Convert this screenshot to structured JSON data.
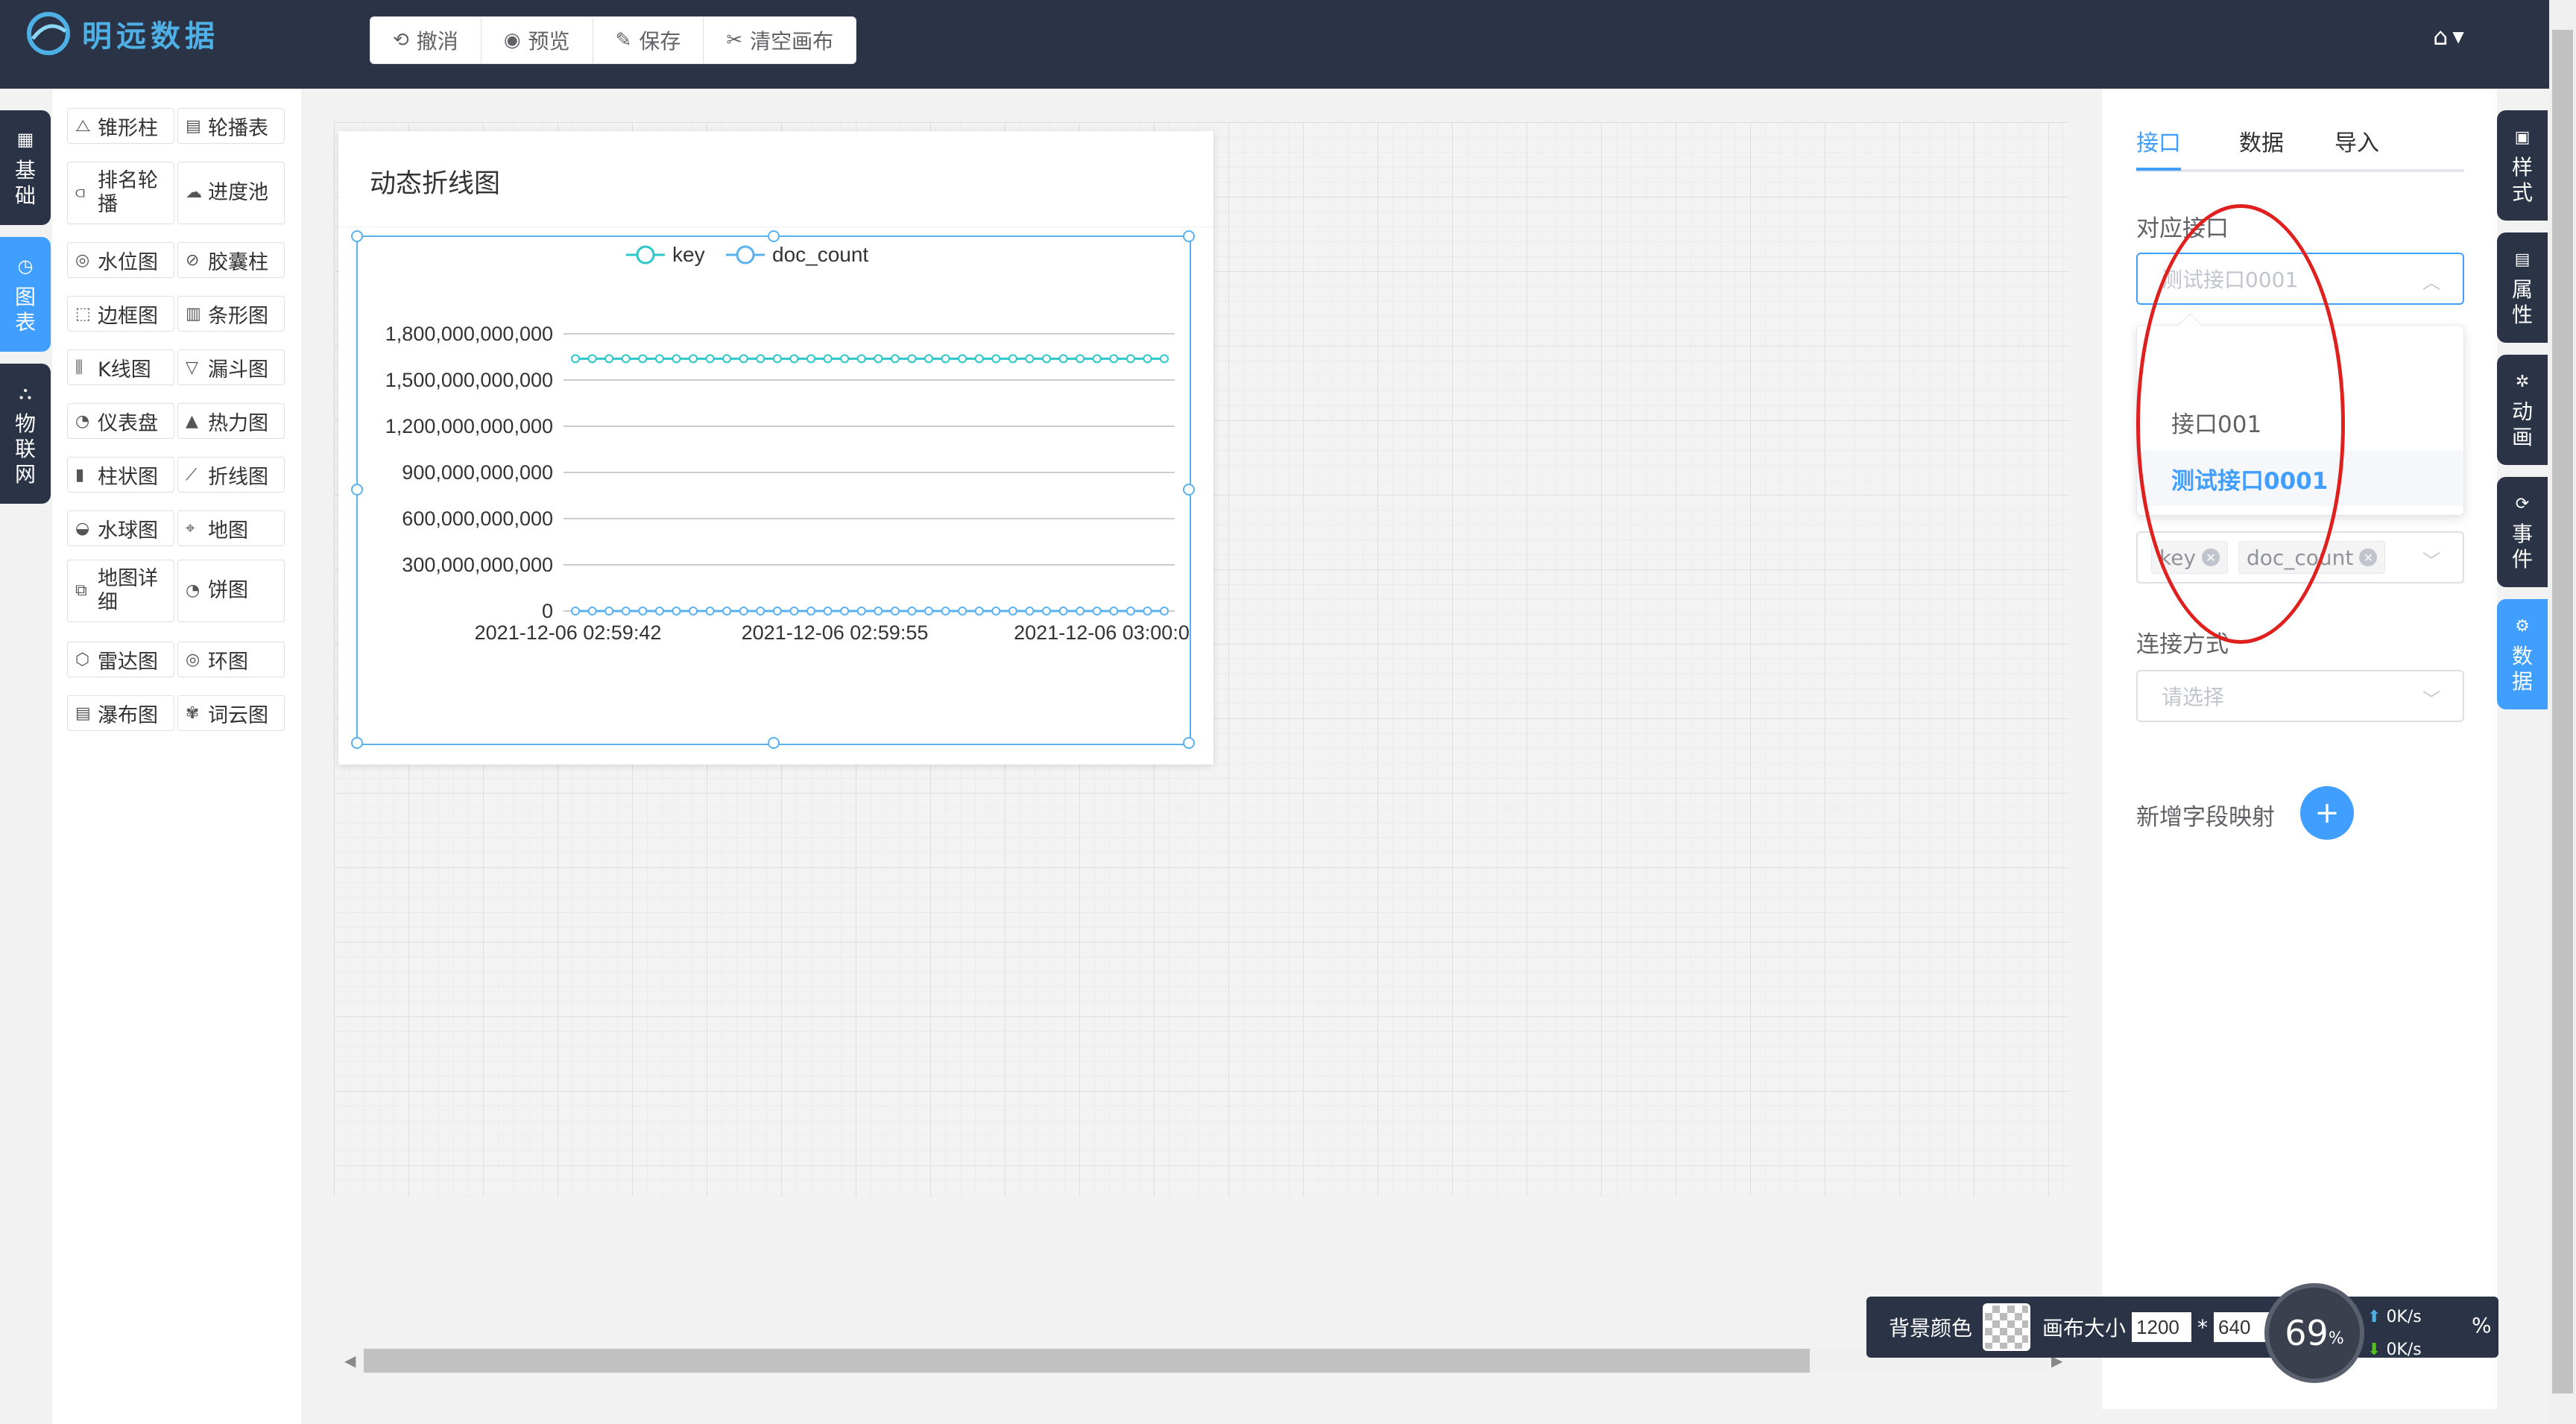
{
  "app": {
    "brand": "明远数据"
  },
  "toolbar": {
    "undo": "撤消",
    "preview": "预览",
    "save": "保存",
    "clear": "清空画布"
  },
  "left_tabs": [
    {
      "label": "基础",
      "icon": "grid-icon",
      "glyph": "▦"
    },
    {
      "label": "图表",
      "icon": "clock-icon",
      "glyph": "◷"
    },
    {
      "label": "物联网",
      "icon": "network-icon",
      "glyph": "⛬"
    }
  ],
  "palette": [
    {
      "label": "锥形柱",
      "glyph": "⧍"
    },
    {
      "label": "轮播表",
      "glyph": "▤"
    },
    {
      "label": "排名轮播",
      "glyph": "⫏"
    },
    {
      "label": "进度池",
      "glyph": "☁"
    },
    {
      "label": "水位图",
      "glyph": "◎"
    },
    {
      "label": "胶囊柱",
      "glyph": "⊘"
    },
    {
      "label": "边框图",
      "glyph": "⬚"
    },
    {
      "label": "条形图",
      "glyph": "▥"
    },
    {
      "label": "K线图",
      "glyph": "⫼"
    },
    {
      "label": "漏斗图",
      "glyph": "▽"
    },
    {
      "label": "仪表盘",
      "glyph": "◔"
    },
    {
      "label": "热力图",
      "glyph": "▲"
    },
    {
      "label": "柱状图",
      "glyph": "▮"
    },
    {
      "label": "折线图",
      "glyph": "⟋"
    },
    {
      "label": "水球图",
      "glyph": "◒"
    },
    {
      "label": "地图",
      "glyph": "⌖"
    },
    {
      "label": "地图详细",
      "glyph": "⧉"
    },
    {
      "label": "饼图",
      "glyph": "◔"
    },
    {
      "label": "雷达图",
      "glyph": "⬡"
    },
    {
      "label": "环图",
      "glyph": "◎"
    },
    {
      "label": "瀑布图",
      "glyph": "▤"
    },
    {
      "label": "词云图",
      "glyph": "✾"
    }
  ],
  "widget": {
    "title": "动态折线图"
  },
  "chart_data": {
    "type": "line",
    "legend": [
      "key",
      "doc_count"
    ],
    "series": [
      {
        "name": "key",
        "color": "#2ec7c9",
        "value": 1638730000000,
        "points": 36
      },
      {
        "name": "doc_count",
        "color": "#5ab1ef",
        "value": 0,
        "points": 36
      }
    ],
    "x_ticks": [
      "2021-12-06 02:59:42",
      "2021-12-06 02:59:55",
      "2021-12-06 03:00:0"
    ],
    "y_ticks": [
      "0",
      "300,000,000,000",
      "600,000,000,000",
      "900,000,000,000",
      "1,200,000,000,000",
      "1,500,000,000,000",
      "1,800,000,000,000"
    ],
    "ylim": [
      0,
      1800000000000
    ]
  },
  "right_panel": {
    "tabs": [
      "接口",
      "数据",
      "导入"
    ],
    "interface_label": "对应接口",
    "interface_value": "测试接口0001",
    "options": [
      "接口001",
      "测试接口0001"
    ],
    "field_tags": [
      "key",
      "doc_count"
    ],
    "connect_label": "连接方式",
    "connect_placeholder": "请选择",
    "add_mapping_label": "新增字段映射"
  },
  "right_tabs": [
    {
      "label": "样式",
      "glyph": "▣"
    },
    {
      "label": "属性",
      "glyph": "▤"
    },
    {
      "label": "动画",
      "glyph": "✲"
    },
    {
      "label": "事件",
      "glyph": "⟳"
    },
    {
      "label": "数据",
      "glyph": "⚙"
    }
  ],
  "status": {
    "bg_color_label": "背景颜色",
    "canvas_size_label": "画布大小",
    "width": "1200",
    "height": "640",
    "times": "*",
    "gauge_value": "69",
    "gauge_unit": "%",
    "upload": "0K/s",
    "download": "0K/s",
    "percent_sign": "%"
  }
}
